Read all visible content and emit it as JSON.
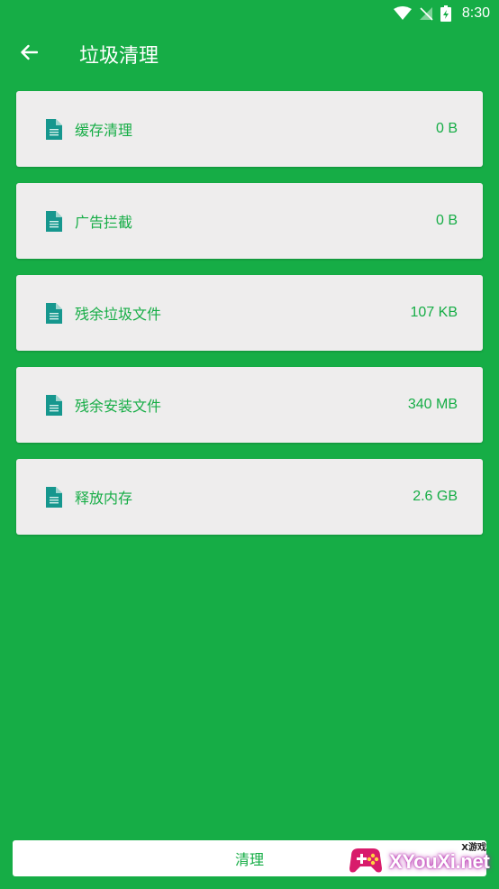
{
  "status_bar": {
    "time": "8:30",
    "icons": [
      "wifi-icon",
      "signal-off-icon",
      "battery-icon"
    ]
  },
  "app_bar": {
    "back_icon": "arrow-left-icon",
    "title": "垃圾清理"
  },
  "items": [
    {
      "label": "缓存清理",
      "value": "0 B",
      "icon": "document-icon"
    },
    {
      "label": "广告拦截",
      "value": "0 B",
      "icon": "document-icon"
    },
    {
      "label": "残余垃圾文件",
      "value": "107 KB",
      "icon": "document-icon"
    },
    {
      "label": "残余安装文件",
      "value": "340 MB",
      "icon": "document-icon"
    },
    {
      "label": "释放内存",
      "value": "2.6 GB",
      "icon": "document-icon"
    }
  ],
  "clean_button": {
    "label": "清理"
  },
  "watermark": {
    "brand": "XYouXi.net",
    "small": "X游戏"
  },
  "colors": {
    "primary": "#16ad46",
    "card_bg": "#eeeded",
    "icon": "#16978e"
  }
}
